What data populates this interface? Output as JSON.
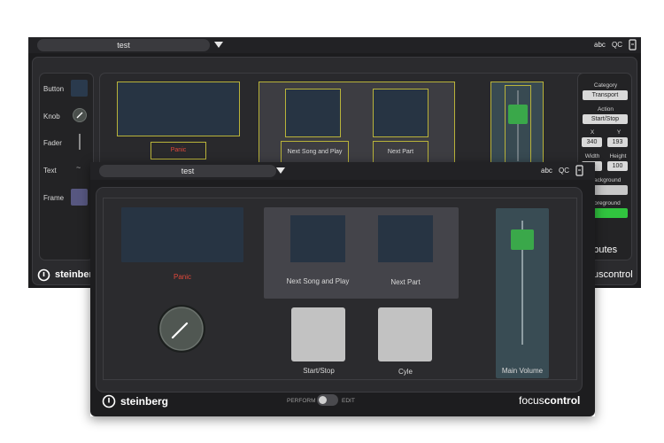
{
  "back_window": {
    "name": "test",
    "toolbar": {
      "abc": "abc",
      "qc": "QC"
    },
    "palette": [
      {
        "label": "Button"
      },
      {
        "label": "Knob"
      },
      {
        "label": "Fader"
      },
      {
        "label": "Text",
        "glyph": "~"
      },
      {
        "label": "Frame"
      }
    ],
    "canvas": {
      "panic_label": "Panic",
      "next_song_label": "Next Song and Play",
      "next_part_label": "Next Part"
    },
    "attributes": {
      "title": "ttributes",
      "category_label": "Category",
      "category_value": "Transport",
      "action_label": "Action",
      "action_value": "Start/Stop",
      "x_label": "X",
      "x_value": "340",
      "y_label": "Y",
      "y_value": "193",
      "width_label": "Width",
      "width_value": "00",
      "height_label": "Height",
      "height_value": "100",
      "background_label": "Background",
      "background_color": "#c8c8c8",
      "foreground_label": "Foreground",
      "foreground_color": "#31c43f"
    },
    "brand": "steinberg",
    "product": "uscontrol"
  },
  "front_window": {
    "name": "test",
    "toolbar": {
      "abc": "abc",
      "qc": "QC"
    },
    "controls": {
      "panic_label": "Panic",
      "next_song_label": "Next Song and Play",
      "next_part_label": "Next Part",
      "start_stop_label": "Start/Stop",
      "cyle_label": "Cyle",
      "main_volume_label": "Main Volume"
    },
    "footer": {
      "brand": "steinberg",
      "perform_label": "PERFORM",
      "edit_label": "EDIT",
      "product_prefix": "focus",
      "product_suffix": "control"
    }
  },
  "colors": {
    "panic_red": "#e0483a",
    "selection_yellow": "#b9b33a",
    "fader_green": "#3aa84a"
  }
}
